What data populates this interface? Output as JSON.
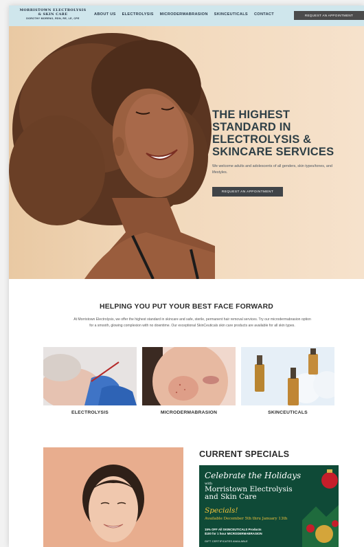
{
  "header": {
    "logo_line1": "MORRISTOWN ELECTROLYSIS",
    "logo_line2": "& SKIN CARE",
    "logo_line3": "DOROTHY MORENO, RDN, RE, LE, CPE",
    "nav": [
      "ABOUT US",
      "ELECTROLYSIS",
      "MICRODERMABRASION",
      "SKINCEUTICALS",
      "CONTACT"
    ],
    "cta": "REQUEST AN APPOINTMENT"
  },
  "hero": {
    "title_lines": [
      "THE HIGHEST",
      "STANDARD IN",
      "ELECTROLYSIS &",
      "SKINCARE SERVICES"
    ],
    "subtitle": "We welcome adults and adolescents of all genders, skin types/tones, and lifestyles.",
    "cta": "REQUEST AN APPOINTMENT"
  },
  "intro": {
    "title": "HELPING YOU PUT YOUR BEST FACE FORWARD",
    "text": "At Morristown Electrolysis, we offer the highest standard in skincare and safe, sterile, permanent hair removal services. Try our microdermabrasion option for a smooth, glowing complexion with no downtime. Our exceptional SkinCeuticals skin care products are available for all skin types."
  },
  "services": [
    "ELECTROLYSIS",
    "MICRODERMABRASION",
    "SKINCEUTICALS"
  ],
  "specials": {
    "title": "CURRENT SPECIALS",
    "promo_headline": "Celebrate the Holidays",
    "promo_with": "with",
    "promo_business": "Morristown Electrolysis and Skin Care",
    "promo_specials": "Specials!",
    "promo_dates": "Available December 5th thru January 13th",
    "promo_offer1": "15% OFF All SKINCEUTICALS Products",
    "promo_offer2": "$100 for 1 hour MICRODERMABRASION",
    "promo_gift": "GIFT CERTIFICATES AVAILABLE"
  },
  "colors": {
    "header_bg": "#cfe6ec",
    "button_dark": "#4b4b4b",
    "hero_title": "#2e3f46",
    "promo_bg": "#0f4a37",
    "promo_gold": "#f2c33b"
  }
}
